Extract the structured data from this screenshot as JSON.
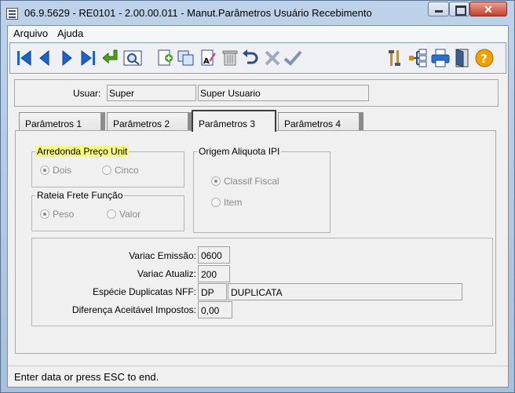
{
  "window": {
    "title": "06.9.5629 - RE0101 - 2.00.00.011 - Manut.Parâmetros Usuário Recebimento",
    "close_label": "✕"
  },
  "menu": {
    "items": [
      {
        "label": "Arquivo"
      },
      {
        "label": "Ajuda"
      }
    ]
  },
  "toolbar": {
    "left": [
      "first-record-icon",
      "previous-record-icon",
      "next-record-icon",
      "last-record-icon",
      "go-to-icon",
      "search-icon",
      "add-icon",
      "copy-icon",
      "edit-icon",
      "delete-icon",
      "undo-icon",
      "cancel-icon",
      "save-icon"
    ],
    "right": [
      "tools-icon",
      "hierarchy-icon",
      "print-icon",
      "exit-icon",
      "help-icon"
    ]
  },
  "user": {
    "label": "Usuar:",
    "code": "Super",
    "name": "Super Usuario"
  },
  "tabs": [
    {
      "label": "Parâmetros 1"
    },
    {
      "label": "Parâmetros 2"
    },
    {
      "label": "Parâmetros 3",
      "active": true
    },
    {
      "label": "Parâmetros 4"
    }
  ],
  "groups": {
    "arredonda": {
      "title": "Arredonda Preço Unit",
      "options": [
        "Dois",
        "Cinco"
      ],
      "selected": "Dois"
    },
    "rateia": {
      "title": "Rateia Frete Função",
      "options": [
        "Peso",
        "Valor"
      ],
      "selected": "Peso"
    },
    "origem": {
      "title": "Origem Aliquota IPI",
      "options": [
        "Classif Fiscal",
        "Item"
      ],
      "selected": "Classif Fiscal"
    }
  },
  "fields": {
    "variac_emissao": {
      "label": "Variac Emissão:",
      "value": "0600"
    },
    "variac_atualiz": {
      "label": "Variac Atualiz:",
      "value": "200"
    },
    "especie": {
      "label": "Espécie Duplicatas NFF:",
      "code": "DP",
      "description": "DUPLICATA"
    },
    "diferenca": {
      "label": "Diferença Aceitável Impostos:",
      "value": "0,00"
    }
  },
  "status": {
    "text": "Enter data or press ESC to end."
  },
  "colors": {
    "highlight": "#f7f97a",
    "toolbar_blue": "#1f63c6",
    "help_orange": "#f0a000"
  }
}
